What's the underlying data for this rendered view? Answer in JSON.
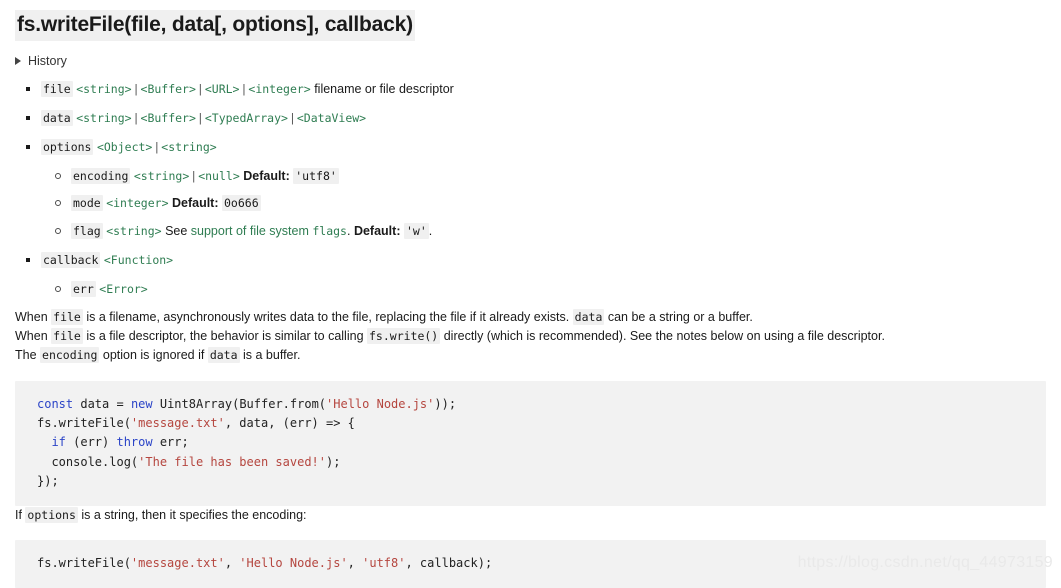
{
  "document": {
    "title": "fs.writeFile(file, data[, options], callback)",
    "history_label": "History",
    "history_icon": "triangle-right-icon"
  },
  "parameters": [
    {
      "name": "file",
      "types": [
        "<string>",
        "<Buffer>",
        "<URL>",
        "<integer>"
      ],
      "description": "filename or file descriptor"
    },
    {
      "name": "data",
      "types": [
        "<string>",
        "<Buffer>",
        "<TypedArray>",
        "<DataView>"
      ],
      "description": ""
    },
    {
      "name": "options",
      "types": [
        "<Object>",
        "<string>"
      ],
      "description": "",
      "children": [
        {
          "name": "encoding",
          "types": [
            "<string>",
            "<null>"
          ],
          "default_label": "Default:",
          "default_value": "'utf8'"
        },
        {
          "name": "mode",
          "types": [
            "<integer>"
          ],
          "default_label": "Default:",
          "default_value": "0o666"
        },
        {
          "name": "flag",
          "types": [
            "<string>"
          ],
          "see_prefix": "See ",
          "link_text": "support of file system ",
          "link_code": "flags",
          "see_suffix": ".",
          "default_label": "Default:",
          "default_value": "'w'",
          "trailing": "."
        }
      ]
    },
    {
      "name": "callback",
      "types": [
        "<Function>"
      ],
      "description": "",
      "children": [
        {
          "name": "err",
          "types": [
            "<Error>"
          ]
        }
      ]
    }
  ],
  "paragraphs": {
    "p1": {
      "part1": "When ",
      "code1": "file",
      "part2": " is a filename, asynchronously writes data to the file, replacing the file if it already exists. ",
      "code2": "data",
      "part3": " can be a string or a buffer."
    },
    "p2": {
      "part1": "When ",
      "code1": "file",
      "part2": " is a file descriptor, the behavior is similar to calling ",
      "code2": "fs.write()",
      "part3": " directly (which is recommended). See the notes below on using a file descriptor."
    },
    "p3": {
      "part1": "The ",
      "code1": "encoding",
      "part2": " option is ignored if ",
      "code2": "data",
      "part3": " is a buffer."
    },
    "p4": {
      "part1": "If ",
      "code1": "options",
      "part2": " is a string, then it specifies the encoding:"
    }
  },
  "code_block_1": {
    "lines": [
      [
        {
          "t": "const",
          "c": "kw"
        },
        {
          "t": " data ",
          "c": "plain"
        },
        {
          "t": "= ",
          "c": "plain"
        },
        {
          "t": "new",
          "c": "kw"
        },
        {
          "t": " Uint8Array(Buffer.from(",
          "c": "plain"
        },
        {
          "t": "'Hello Node.js'",
          "c": "str"
        },
        {
          "t": "));",
          "c": "plain"
        }
      ],
      [
        {
          "t": "fs.writeFile(",
          "c": "plain"
        },
        {
          "t": "'message.txt'",
          "c": "str"
        },
        {
          "t": ", data, (err) => {",
          "c": "plain"
        }
      ],
      [
        {
          "t": "  ",
          "c": "plain"
        },
        {
          "t": "if",
          "c": "kw"
        },
        {
          "t": " (err) ",
          "c": "plain"
        },
        {
          "t": "throw",
          "c": "kw"
        },
        {
          "t": " err;",
          "c": "plain"
        }
      ],
      [
        {
          "t": "  console.log(",
          "c": "plain"
        },
        {
          "t": "'The file has been saved!'",
          "c": "str"
        },
        {
          "t": ");",
          "c": "plain"
        }
      ],
      [
        {
          "t": "});",
          "c": "plain"
        }
      ]
    ]
  },
  "code_block_2": {
    "lines": [
      [
        {
          "t": "fs.writeFile(",
          "c": "plain"
        },
        {
          "t": "'message.txt'",
          "c": "str"
        },
        {
          "t": ", ",
          "c": "plain"
        },
        {
          "t": "'Hello Node.js'",
          "c": "str"
        },
        {
          "t": ", ",
          "c": "plain"
        },
        {
          "t": "'utf8'",
          "c": "str"
        },
        {
          "t": ", callback);",
          "c": "plain"
        }
      ]
    ]
  },
  "watermark": {
    "text": "https://blog.csdn.net/qq_44973159"
  },
  "colors": {
    "type_link": "#2f7d52",
    "keyword": "#2b44c7",
    "string": "#b5463f",
    "code_bg": "#f2f2f2",
    "inline_code_bg": "#f0f0f0",
    "title_bg": "#f0f0f0",
    "text": "#1a1a1a"
  }
}
